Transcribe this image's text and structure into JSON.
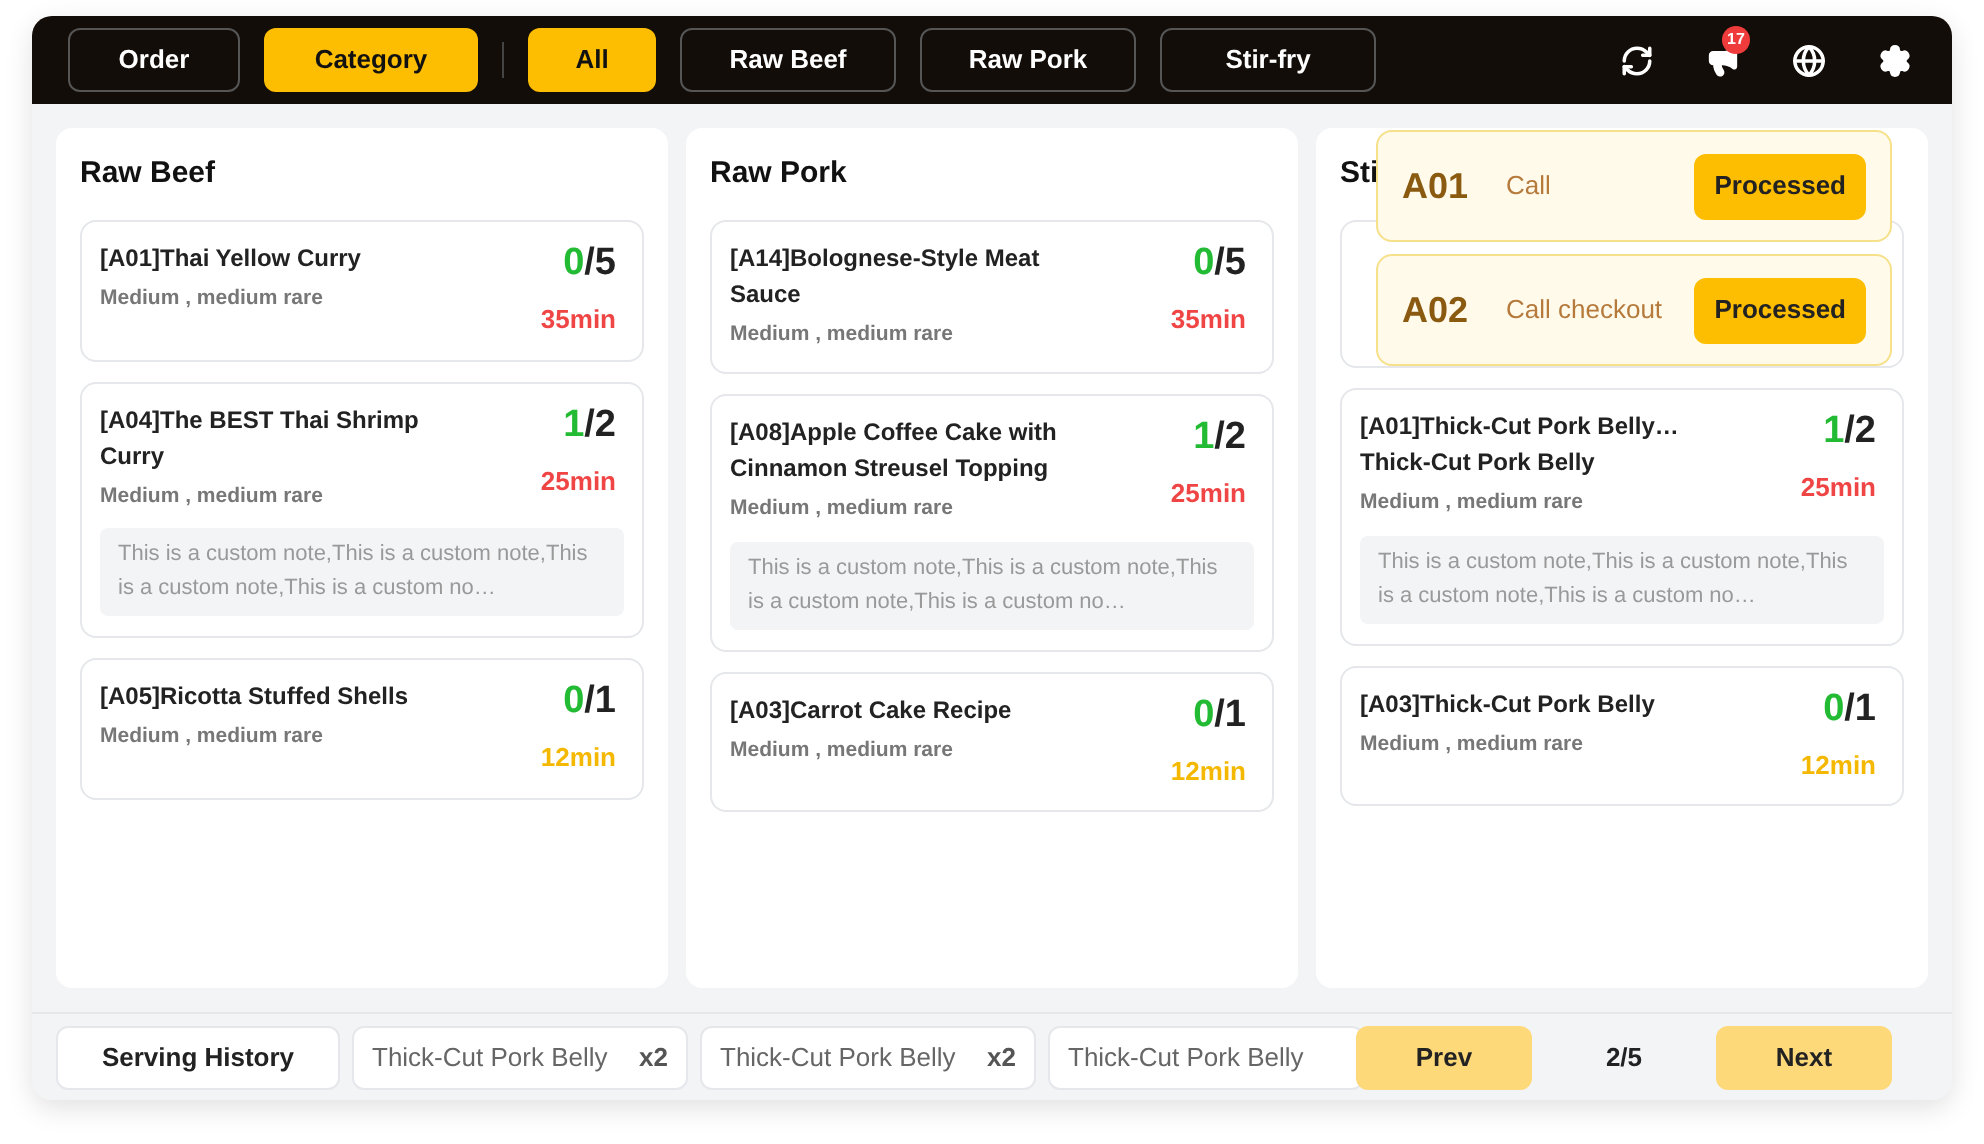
{
  "top_bar": {
    "modes": [
      {
        "label": "Order",
        "selected": false
      },
      {
        "label": "Category",
        "selected": true
      }
    ],
    "filters": [
      {
        "label": "All",
        "selected": true
      },
      {
        "label": "Raw Beef",
        "selected": false
      },
      {
        "label": "Raw Pork",
        "selected": false
      },
      {
        "label": "Stir-fry",
        "selected": false
      }
    ],
    "notification_badge": "17"
  },
  "columns": [
    {
      "title": "Raw Beef",
      "cards": [
        {
          "title": "[A01]Thai Yellow Curry",
          "options": "Medium , medium rare",
          "done": "0",
          "total": "/5",
          "time": "35min",
          "urgent": true
        },
        {
          "title": "[A04]The BEST Thai Shrimp Curry",
          "options": "Medium , medium rare",
          "done": "1",
          "total": "/2",
          "time": "25min",
          "urgent": true,
          "note": "This is a custom note,This is a custom note,This is a custom note,This is a custom no…"
        },
        {
          "title": "[A05]Ricotta Stuffed Shells",
          "options": "Medium , medium rare",
          "done": "0",
          "total": "/1",
          "time": "12min",
          "urgent": false
        }
      ]
    },
    {
      "title": "Raw Pork",
      "cards": [
        {
          "title": "[A14]Bolognese-Style Meat Sauce",
          "options": "Medium , medium rare",
          "done": "0",
          "total": "/5",
          "time": "35min",
          "urgent": true
        },
        {
          "title": "[A08]Apple Coffee Cake with Cinnamon Streusel Topping",
          "options": "Medium , medium rare",
          "done": "1",
          "total": "/2",
          "time": "25min",
          "urgent": true,
          "note": "This is a custom note,This is a custom note,This is a custom note,This is a custom no…"
        },
        {
          "title": "[A03]Carrot Cake Recipe",
          "options": "Medium , medium rare",
          "done": "0",
          "total": "/1",
          "time": "12min",
          "urgent": false
        }
      ]
    },
    {
      "title": "Sti",
      "cards": [
        {
          "kind": "covered"
        },
        {
          "title": "[A01]Thick-Cut Pork Belly… Thick-Cut Pork Belly",
          "options": "Medium , medium rare",
          "done": "1",
          "total": "/2",
          "time": "25min",
          "urgent": true,
          "note": "This is a custom note,This is a custom note,This is a custom note,This is a custom no…"
        },
        {
          "title": "[A03]Thick-Cut Pork Belly",
          "options": "Medium , medium rare",
          "done": "0",
          "total": "/1",
          "time": "12min",
          "urgent": false
        }
      ]
    }
  ],
  "calls": [
    {
      "table": "A01",
      "message": "Call",
      "action": "Processed"
    },
    {
      "table": "A02",
      "message": "Call checkout",
      "action": "Processed"
    }
  ],
  "bottom_bar": {
    "history_button": "Serving History",
    "served": [
      {
        "name": "Thick-Cut Pork Belly",
        "count": "x2"
      },
      {
        "name": "Thick-Cut Pork Belly",
        "count": "x2"
      },
      {
        "name": "Thick-Cut Pork Belly"
      }
    ],
    "prev": "Prev",
    "page": "2/5",
    "next": "Next"
  }
}
